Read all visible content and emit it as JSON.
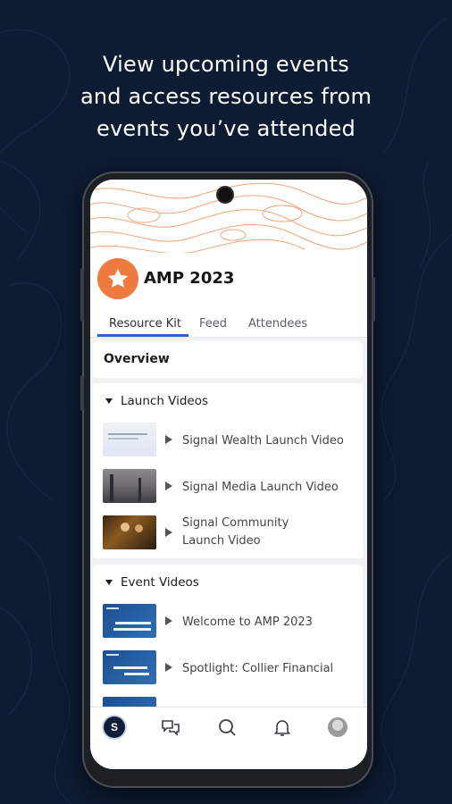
{
  "headline": {
    "line1": "View upcoming events",
    "line2": "and access resources from",
    "line3": "events you’ve attended"
  },
  "event": {
    "title": "AMP 2023",
    "logo_icon": "star-icon",
    "accent_color": "#ef7a3f"
  },
  "tabs": [
    {
      "label": "Resource Kit",
      "active": true
    },
    {
      "label": "Feed",
      "active": false
    },
    {
      "label": "Attendees",
      "active": false
    }
  ],
  "overview": {
    "label": "Overview"
  },
  "sections": [
    {
      "title": "Launch Videos",
      "items": [
        {
          "title": "Signal Wealth Launch Video"
        },
        {
          "title": "Signal Media Launch Video"
        },
        {
          "title": "Signal Community Launch Video",
          "line1": "Signal Community",
          "line2": "Launch Video"
        }
      ]
    },
    {
      "title": "Event Videos",
      "items": [
        {
          "title": "Welcome to AMP 2023"
        },
        {
          "title": "Spotlight: Collier Financial"
        },
        {
          "title": ""
        }
      ]
    }
  ],
  "bottom_nav": [
    {
      "icon": "home-logo-icon",
      "label": "S"
    },
    {
      "icon": "chat-bubbles-icon"
    },
    {
      "icon": "search-icon"
    },
    {
      "icon": "bell-icon"
    },
    {
      "icon": "profile-avatar-icon"
    }
  ],
  "colors": {
    "background": "#0d1b33",
    "tab_indicator": "#2e63c6",
    "nav_home": "#0f1c3a"
  }
}
